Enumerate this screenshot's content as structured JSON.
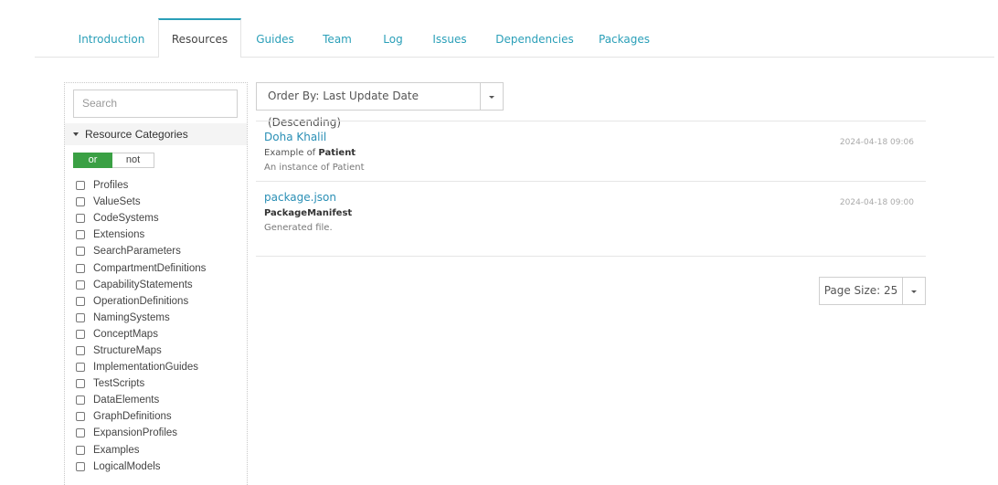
{
  "tabs": [
    {
      "label": "Introduction",
      "active": false
    },
    {
      "label": "Resources",
      "active": true
    },
    {
      "label": "Guides",
      "active": false
    },
    {
      "label": "Team",
      "active": false
    },
    {
      "label": "Log",
      "active": false
    },
    {
      "label": "Issues",
      "active": false
    },
    {
      "label": "Dependencies",
      "active": false
    },
    {
      "label": "Packages",
      "active": false
    }
  ],
  "sidebar": {
    "search_placeholder": "Search",
    "categories_heading": "Resource Categories",
    "toggle": {
      "or": "or",
      "not": "not",
      "selected": "or"
    },
    "categories": [
      "Profiles",
      "ValueSets",
      "CodeSystems",
      "Extensions",
      "SearchParameters",
      "CompartmentDefinitions",
      "CapabilityStatements",
      "OperationDefinitions",
      "NamingSystems",
      "ConceptMaps",
      "StructureMaps",
      "ImplementationGuides",
      "TestScripts",
      "DataElements",
      "GraphDefinitions",
      "ExpansionProfiles",
      "Examples",
      "LogicalModels"
    ]
  },
  "main": {
    "order_by_label": "Order By: Last Update Date (Descending)",
    "results": [
      {
        "title": "Doha Khalil",
        "subtitle_prefix": "Example of ",
        "subtitle_bold": "Patient",
        "description": "An instance of Patient",
        "date": "2024-04-18 09:06"
      },
      {
        "title": "package.json",
        "subtitle_prefix": "",
        "subtitle_bold": "PackageManifest",
        "description": "Generated file.",
        "date": "2024-04-18 09:00"
      }
    ],
    "page_size_label": "Page Size: 25"
  },
  "colors": {
    "accent": "#2a9fb8",
    "link": "#2a8fb5",
    "toggle_on": "#3aa044"
  }
}
